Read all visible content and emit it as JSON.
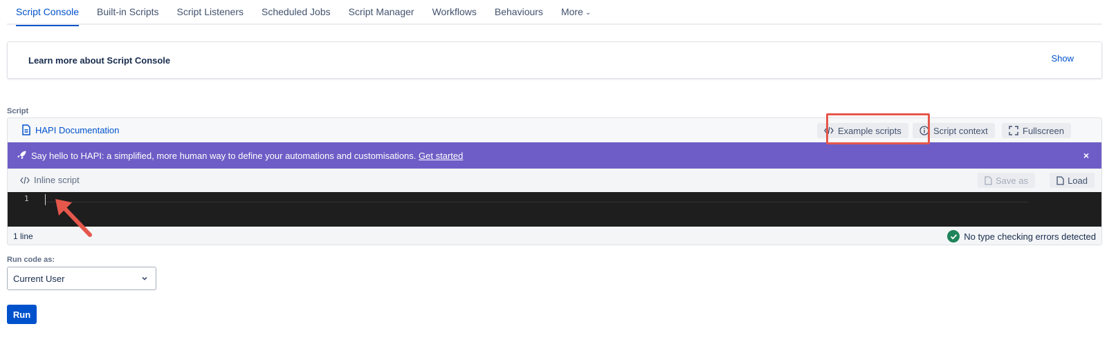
{
  "tabs": [
    {
      "label": "Script Console",
      "active": true
    },
    {
      "label": "Built-in Scripts"
    },
    {
      "label": "Script Listeners"
    },
    {
      "label": "Scheduled Jobs"
    },
    {
      "label": "Script Manager"
    },
    {
      "label": "Workflows"
    },
    {
      "label": "Behaviours"
    },
    {
      "label": "More"
    }
  ],
  "learn": {
    "title": "Learn more about Script Console",
    "show_label": "Show"
  },
  "script_label": "Script",
  "editor": {
    "doc_link": "HAPI Documentation",
    "example_scripts": "Example scripts",
    "script_context": "Script context",
    "fullscreen": "Fullscreen",
    "banner": {
      "message": "Say hello to HAPI: a simplified, more human way to define your automations and customisations.",
      "link": "Get started",
      "close": "×"
    },
    "inline_script": "Inline script",
    "save_as": "Save as",
    "load": "Load",
    "line_number": "1",
    "line_count": "1 line",
    "status": "No type checking errors detected"
  },
  "run_as": {
    "label": "Run code as:",
    "value": "Current User"
  },
  "run_button": "Run",
  "colors": {
    "accent": "#0052cc",
    "banner": "#6e5dc6",
    "code_bg": "#1e1e1e",
    "success": "#1f845a",
    "annotation": "#e5574b"
  },
  "icons": [
    "document-icon",
    "code-icon",
    "info-icon",
    "fullscreen-icon",
    "rocket-icon",
    "close-icon",
    "file-icon",
    "check-icon",
    "chevron-down-icon"
  ]
}
